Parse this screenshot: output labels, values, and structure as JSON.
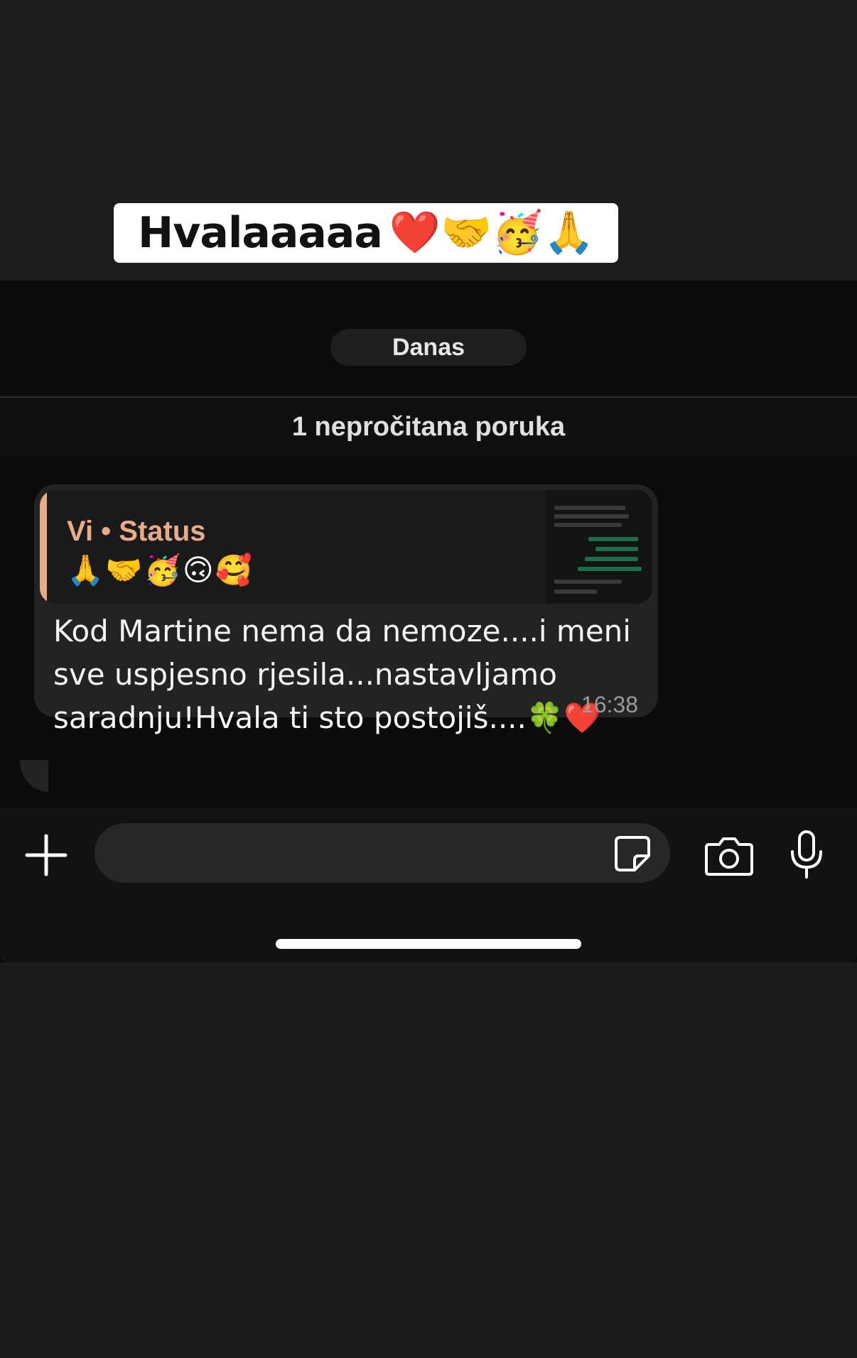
{
  "sticker": {
    "text": "Hvalaaaaa",
    "emojis": "❤️🤝🥳🙏"
  },
  "chat": {
    "date_label": "Danas",
    "unread_label": "1 nepročitana poruka",
    "message": {
      "quote_author": "Vi • Status",
      "quote_emojis": "🙏🤝🥳🙃🥰",
      "text": "Kod Martine nema da nemoze....i meni sve uspjesno rjesila...nastavljamo saradnju!Hvala ti sto postojiš....🍀❤️",
      "time": "16:38"
    }
  },
  "composer": {
    "plus_icon": "plus-icon",
    "sticker_icon": "sticker-icon",
    "camera_icon": "camera-icon",
    "mic_icon": "microphone-icon"
  },
  "colors": {
    "quote_accent": "#e7ab8a",
    "bubble_bg": "#232323",
    "chat_bg": "#0b0b0b"
  }
}
